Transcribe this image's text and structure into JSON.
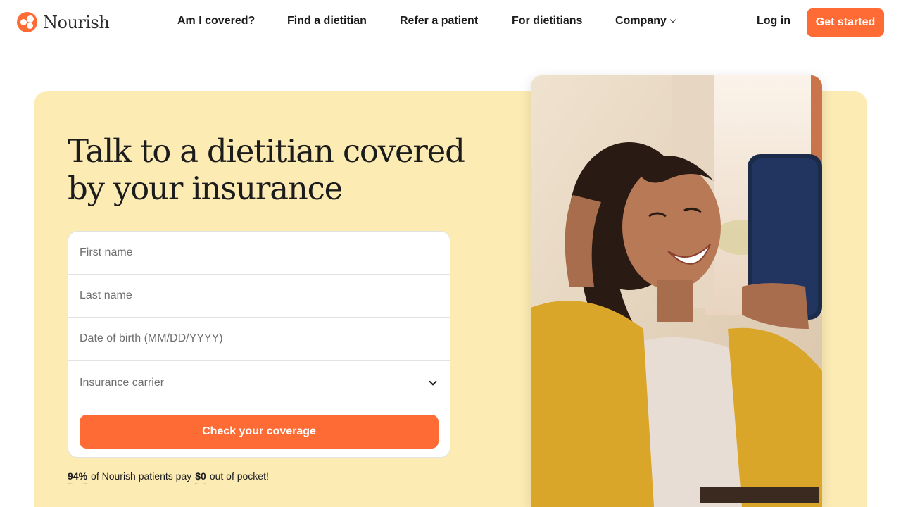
{
  "brand": {
    "name": "Nourish",
    "accent": "#ff6b35",
    "hero_bg": "#fdebb4"
  },
  "nav": {
    "items": [
      {
        "label": "Am I covered?"
      },
      {
        "label": "Find a dietitian"
      },
      {
        "label": "Refer a patient"
      },
      {
        "label": "For dietitians"
      },
      {
        "label": "Company",
        "has_dropdown": true
      }
    ],
    "login_label": "Log in",
    "cta_label": "Get started"
  },
  "hero": {
    "title": "Talk to a dietitian covered by your insurance",
    "form": {
      "first_name_placeholder": "First name",
      "last_name_placeholder": "Last name",
      "dob_placeholder": "Date of birth (MM/DD/YYYY)",
      "carrier_placeholder": "Insurance carrier",
      "submit_label": "Check your coverage"
    },
    "stat": {
      "percent": "94%",
      "text1": "of Nourish patients pay",
      "amount": "$0",
      "text2": "out of pocket!"
    },
    "image": {
      "icon": "woman-smiling-at-phone-photo"
    }
  }
}
